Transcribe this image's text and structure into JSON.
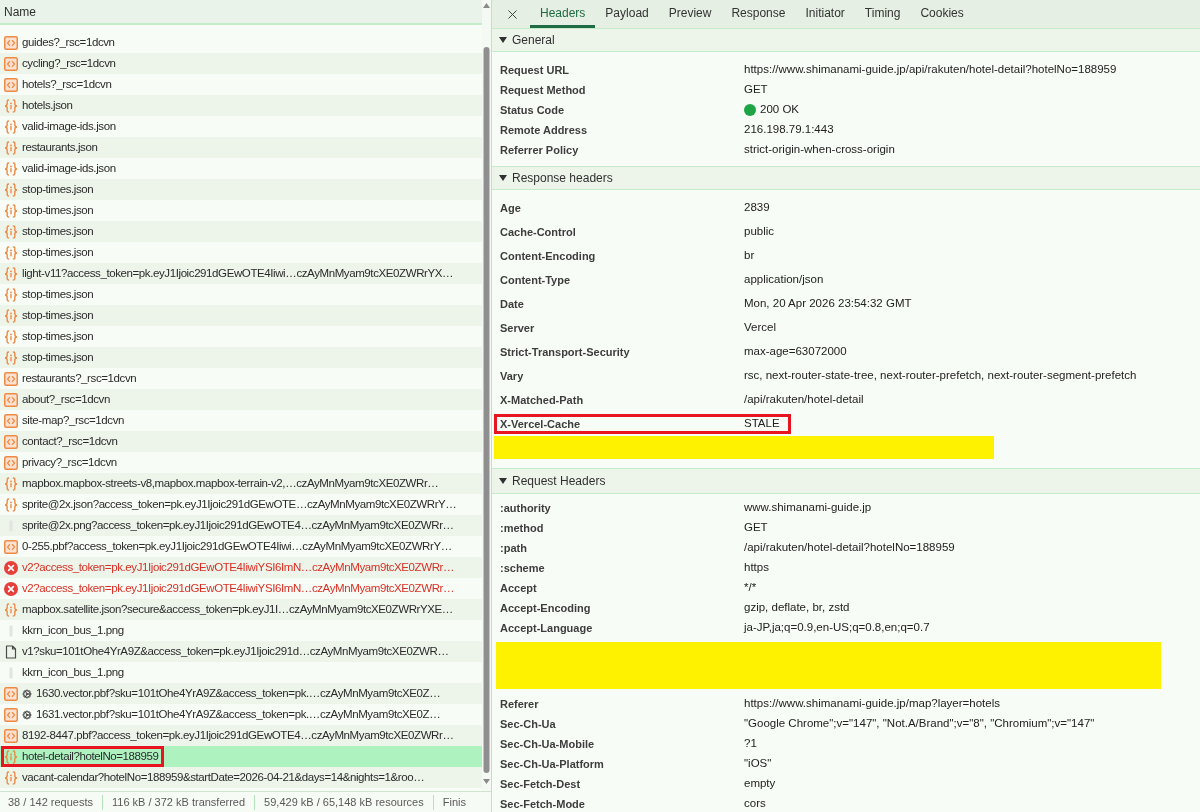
{
  "requests_panel": {
    "column_header": "Name",
    "requests": [
      {
        "name": "guides?_rsc=1dcvn",
        "kind": "document",
        "service_worker": false,
        "selected": false,
        "annotated": false
      },
      {
        "name": "cycling?_rsc=1dcvn",
        "kind": "document",
        "service_worker": false,
        "selected": false,
        "annotated": false
      },
      {
        "name": "hotels?_rsc=1dcvn",
        "kind": "document",
        "service_worker": false,
        "selected": false,
        "annotated": false
      },
      {
        "name": "hotels.json",
        "kind": "fetch",
        "service_worker": false,
        "selected": false,
        "annotated": false
      },
      {
        "name": "valid-image-ids.json",
        "kind": "fetch",
        "service_worker": false,
        "selected": false,
        "annotated": false
      },
      {
        "name": "restaurants.json",
        "kind": "fetch",
        "service_worker": false,
        "selected": false,
        "annotated": false
      },
      {
        "name": "valid-image-ids.json",
        "kind": "fetch",
        "service_worker": false,
        "selected": false,
        "annotated": false
      },
      {
        "name": "stop-times.json",
        "kind": "fetch",
        "service_worker": false,
        "selected": false,
        "annotated": false
      },
      {
        "name": "stop-times.json",
        "kind": "fetch",
        "service_worker": false,
        "selected": false,
        "annotated": false
      },
      {
        "name": "stop-times.json",
        "kind": "fetch",
        "service_worker": false,
        "selected": false,
        "annotated": false
      },
      {
        "name": "stop-times.json",
        "kind": "fetch",
        "service_worker": false,
        "selected": false,
        "annotated": false
      },
      {
        "name": "light-v11?access_token=pk.eyJ1Ijoic291dGEwOTE4Iiwi…czAyMnMyam9tcXE0ZWRrYX…",
        "kind": "fetch",
        "service_worker": false,
        "selected": false,
        "annotated": false
      },
      {
        "name": "stop-times.json",
        "kind": "fetch",
        "service_worker": false,
        "selected": false,
        "annotated": false
      },
      {
        "name": "stop-times.json",
        "kind": "fetch",
        "service_worker": false,
        "selected": false,
        "annotated": false
      },
      {
        "name": "stop-times.json",
        "kind": "fetch",
        "service_worker": false,
        "selected": false,
        "annotated": false
      },
      {
        "name": "stop-times.json",
        "kind": "fetch",
        "service_worker": false,
        "selected": false,
        "annotated": false
      },
      {
        "name": "restaurants?_rsc=1dcvn",
        "kind": "document",
        "service_worker": false,
        "selected": false,
        "annotated": false
      },
      {
        "name": "about?_rsc=1dcvn",
        "kind": "document",
        "service_worker": false,
        "selected": false,
        "annotated": false
      },
      {
        "name": "site-map?_rsc=1dcvn",
        "kind": "document",
        "service_worker": false,
        "selected": false,
        "annotated": false
      },
      {
        "name": "contact?_rsc=1dcvn",
        "kind": "document",
        "service_worker": false,
        "selected": false,
        "annotated": false
      },
      {
        "name": "privacy?_rsc=1dcvn",
        "kind": "document",
        "service_worker": false,
        "selected": false,
        "annotated": false
      },
      {
        "name": "mapbox.mapbox-streets-v8,mapbox.mapbox-terrain-v2,…czAyMnMyam9tcXE0ZWRr…",
        "kind": "fetch",
        "service_worker": false,
        "selected": false,
        "annotated": false
      },
      {
        "name": "sprite@2x.json?access_token=pk.eyJ1Ijoic291dGEwOTE…czAyMnMyam9tcXE0ZWRrY…",
        "kind": "fetch",
        "service_worker": false,
        "selected": false,
        "annotated": false
      },
      {
        "name": "sprite@2x.png?access_token=pk.eyJ1Ijoic291dGEwOTE4…czAyMnMyam9tcXE0ZWRr…",
        "kind": "image",
        "service_worker": false,
        "selected": false,
        "annotated": false
      },
      {
        "name": "0-255.pbf?access_token=pk.eyJ1Ijoic291dGEwOTE4Iiwi…czAyMnMyam9tcXE0ZWRrY…",
        "kind": "document",
        "service_worker": false,
        "selected": false,
        "annotated": false
      },
      {
        "name": "v2?access_token=pk.eyJ1Ijoic291dGEwOTE4IiwiYSI6ImN…czAyMnMyam9tcXE0ZWRr…",
        "kind": "error",
        "service_worker": false,
        "selected": false,
        "annotated": false
      },
      {
        "name": "v2?access_token=pk.eyJ1Ijoic291dGEwOTE4IiwiYSI6ImN…czAyMnMyam9tcXE0ZWRr…",
        "kind": "error",
        "service_worker": false,
        "selected": false,
        "annotated": false
      },
      {
        "name": "mapbox.satellite.json?secure&access_token=pk.eyJ1I…czAyMnMyam9tcXE0ZWRrYXE…",
        "kind": "fetch",
        "service_worker": false,
        "selected": false,
        "annotated": false
      },
      {
        "name": "kkrn_icon_bus_1.png",
        "kind": "image",
        "service_worker": false,
        "selected": false,
        "annotated": false
      },
      {
        "name": "v1?sku=101tOhe4YrA9Z&access_token=pk.eyJ1Ijoic291d…czAyMnMyam9tcXE0ZWR…",
        "kind": "file",
        "service_worker": false,
        "selected": false,
        "annotated": false
      },
      {
        "name": "kkrn_icon_bus_1.png",
        "kind": "image",
        "service_worker": false,
        "selected": false,
        "annotated": false
      },
      {
        "name": "1630.vector.pbf?sku=101tOhe4YrA9Z&access_token=pk.…czAyMnMyam9tcXE0Z…",
        "kind": "document",
        "service_worker": true,
        "selected": false,
        "annotated": false
      },
      {
        "name": "1631.vector.pbf?sku=101tOhe4YrA9Z&access_token=pk.…czAyMnMyam9tcXE0Z…",
        "kind": "document",
        "service_worker": true,
        "selected": false,
        "annotated": false
      },
      {
        "name": "8192-8447.pbf?access_token=pk.eyJ1Ijoic291dGEwOTE4…czAyMnMyam9tcXE0ZWRr…",
        "kind": "document",
        "service_worker": false,
        "selected": false,
        "annotated": false
      },
      {
        "name": "hotel-detail?hotelNo=188959",
        "kind": "fetch",
        "service_worker": false,
        "selected": true,
        "annotated": true
      },
      {
        "name": "vacant-calendar?hotelNo=188959&startDate=2026-04-21&days=14&nights=1&roo…",
        "kind": "fetch",
        "service_worker": false,
        "selected": false,
        "annotated": false
      }
    ]
  },
  "status_bar": {
    "items": [
      "38 / 142 requests",
      "116 kB / 372 kB transferred",
      "59,429 kB / 65,148 kB resources",
      "Finis"
    ]
  },
  "details_panel": {
    "tabs": [
      {
        "label": "Headers",
        "selected": true
      },
      {
        "label": "Payload",
        "selected": false
      },
      {
        "label": "Preview",
        "selected": false
      },
      {
        "label": "Response",
        "selected": false
      },
      {
        "label": "Initiator",
        "selected": false
      },
      {
        "label": "Timing",
        "selected": false
      },
      {
        "label": "Cookies",
        "selected": false
      }
    ],
    "general": {
      "title": "General",
      "expanded": true,
      "rows": [
        {
          "kind": "header",
          "name": "Request URL",
          "value": "https://www.shimanami-guide.jp/api/rakuten/hotel-detail?hotelNo=188959",
          "annotated": false
        },
        {
          "kind": "header",
          "name": "Request Method",
          "value": "GET",
          "annotated": false
        },
        {
          "kind": "header",
          "name": "Status Code",
          "value": "200 OK",
          "color": "#1ea446",
          "annotated": false
        },
        {
          "kind": "header",
          "name": "Remote Address",
          "value": "216.198.79.1:443",
          "annotated": false
        },
        {
          "kind": "header",
          "name": "Referrer Policy",
          "value": "strict-origin-when-cross-origin",
          "annotated": false
        }
      ]
    },
    "response_headers": {
      "title": "Response headers",
      "expanded": true,
      "rows": [
        {
          "kind": "header",
          "name": "Age",
          "value": "2839",
          "annotated": false
        },
        {
          "kind": "header",
          "name": "Cache-Control",
          "value": "public",
          "annotated": false
        },
        {
          "kind": "header",
          "name": "Content-Encoding",
          "value": "br",
          "annotated": false
        },
        {
          "kind": "header",
          "name": "Content-Type",
          "value": "application/json",
          "annotated": false
        },
        {
          "kind": "header",
          "name": "Date",
          "value": "Mon, 20 Apr 2026 23:54:32 GMT",
          "annotated": false
        },
        {
          "kind": "header",
          "name": "Server",
          "value": "Vercel",
          "annotated": false
        },
        {
          "kind": "header",
          "name": "Strict-Transport-Security",
          "value": "max-age=63072000",
          "annotated": false
        },
        {
          "kind": "header",
          "name": "Vary",
          "value": "rsc, next-router-state-tree, next-router-prefetch, next-router-segment-prefetch",
          "annotated": false
        },
        {
          "kind": "header",
          "name": "X-Matched-Path",
          "value": "/api/rakuten/hotel-detail",
          "annotated": false
        },
        {
          "kind": "header",
          "name": "X-Vercel-Cache",
          "value": "STALE",
          "annotated": true
        },
        {
          "kind": "redaction"
        }
      ]
    },
    "request_headers": {
      "title": "Request Headers",
      "expanded": true,
      "rows": [
        {
          "kind": "header",
          "name": ":authority",
          "value": "www.shimanami-guide.jp",
          "annotated": false
        },
        {
          "kind": "header",
          "name": ":method",
          "value": "GET",
          "annotated": false
        },
        {
          "kind": "header",
          "name": ":path",
          "value": "/api/rakuten/hotel-detail?hotelNo=188959",
          "annotated": false
        },
        {
          "kind": "header",
          "name": ":scheme",
          "value": "https",
          "annotated": false
        },
        {
          "kind": "header",
          "name": "Accept",
          "value": "*/*",
          "annotated": false
        },
        {
          "kind": "header",
          "name": "Accept-Encoding",
          "value": "gzip, deflate, br, zstd",
          "annotated": false
        },
        {
          "kind": "header",
          "name": "Accept-Language",
          "value": "ja-JP,ja;q=0.9,en-US;q=0.8,en;q=0.7",
          "annotated": false
        },
        {
          "kind": "redaction"
        },
        {
          "kind": "header",
          "name": "Referer",
          "value": "https://www.shimanami-guide.jp/map?layer=hotels",
          "annotated": false
        },
        {
          "kind": "header",
          "name": "Sec-Ch-Ua",
          "value": "\"Google Chrome\";v=\"147\", \"Not.A/Brand\";v=\"8\", \"Chromium\";v=\"147\"",
          "annotated": false
        },
        {
          "kind": "header",
          "name": "Sec-Ch-Ua-Mobile",
          "value": "?1",
          "annotated": false
        },
        {
          "kind": "header",
          "name": "Sec-Ch-Ua-Platform",
          "value": "\"iOS\"",
          "annotated": false
        },
        {
          "kind": "header",
          "name": "Sec-Fetch-Dest",
          "value": "empty",
          "annotated": false
        },
        {
          "kind": "header",
          "name": "Sec-Fetch-Mode",
          "value": "cors",
          "annotated": false
        }
      ]
    }
  }
}
